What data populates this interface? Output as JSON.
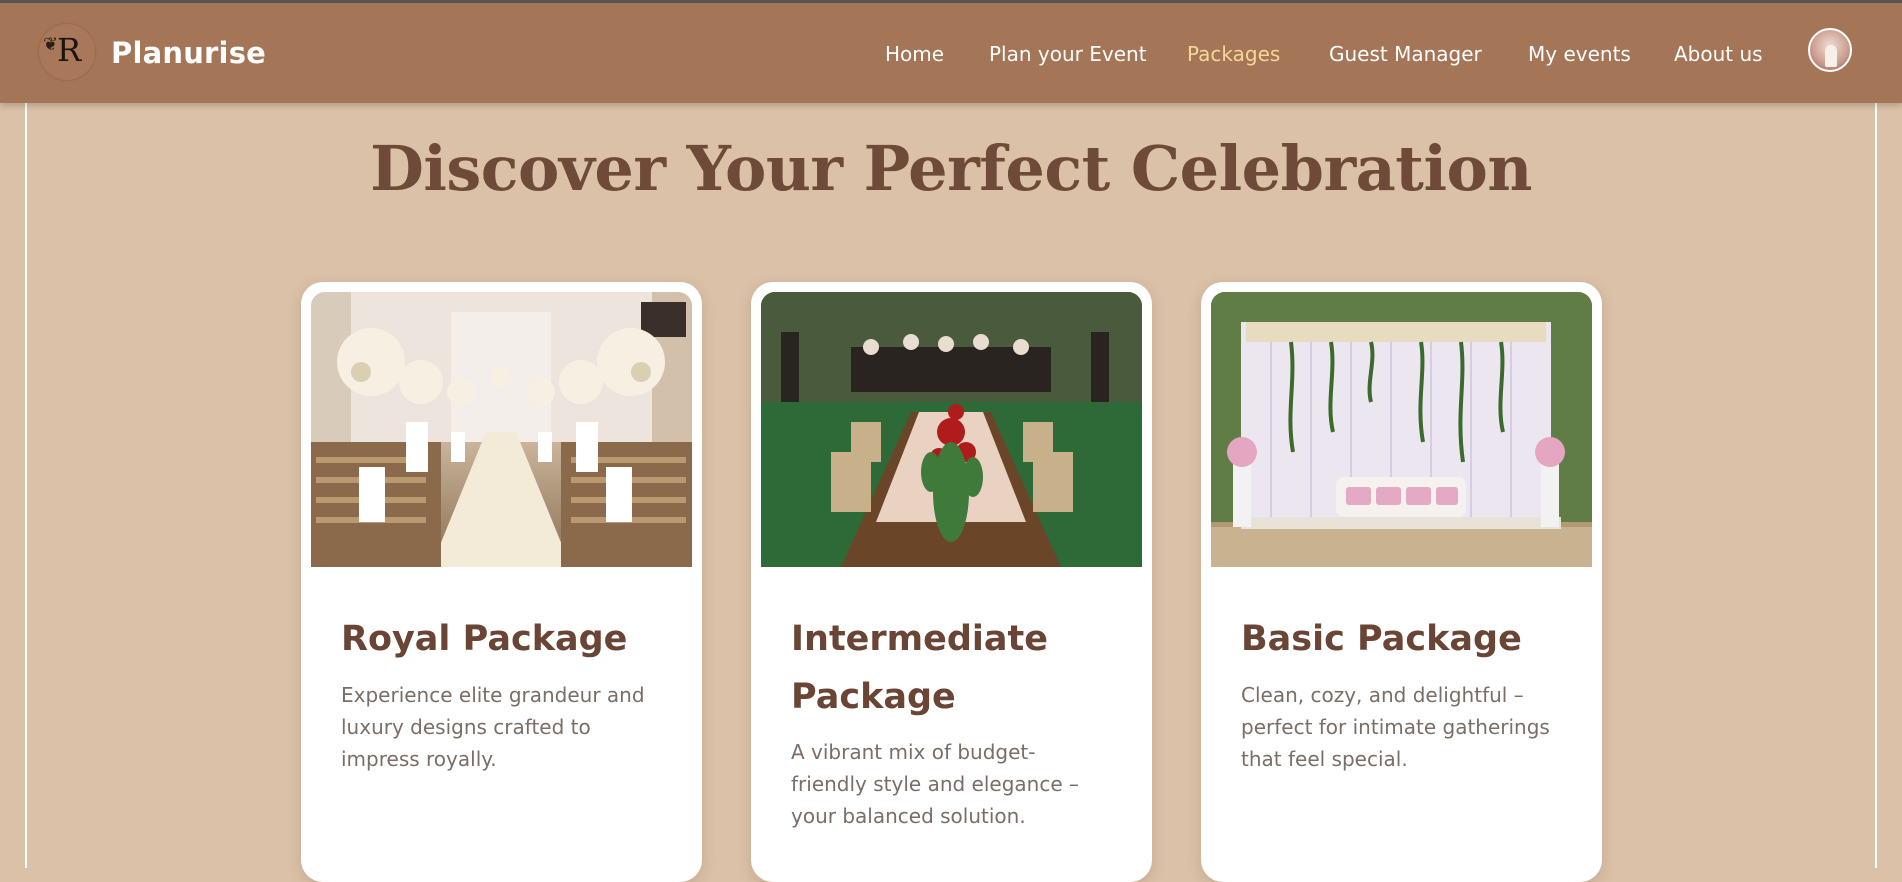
{
  "brand": {
    "name": "Planurise",
    "logo_letter": "R"
  },
  "nav": {
    "items": [
      {
        "label": "Home",
        "active": false
      },
      {
        "label": "Plan your Event",
        "active": false
      },
      {
        "label": "Packages",
        "active": true
      },
      {
        "label": "Guest Manager",
        "active": false
      },
      {
        "label": "My events",
        "active": false
      },
      {
        "label": "About us",
        "active": false
      }
    ]
  },
  "page": {
    "title": "Discover Your Perfect Celebration"
  },
  "packages": [
    {
      "title": "Royal Package",
      "description": "Experience elite grandeur and luxury designs crafted to impress royally.",
      "image": "white floral wedding aisle"
    },
    {
      "title": "Intermediate Package",
      "description": "A vibrant mix of budget-friendly style and elegance – your balanced solution.",
      "image": "outdoor banquet table with red floral centerpiece"
    },
    {
      "title": "Basic Package",
      "description": "Clean, cozy, and delightful – perfect for intimate gatherings that feel special.",
      "image": "white draped stage with floral vines and sofa"
    }
  ],
  "colors": {
    "navbar": "#a47556",
    "background": "#dbc1a7",
    "active_nav": "#f6d79a",
    "heading": "#6e4a38",
    "card_title": "#6a4535"
  }
}
